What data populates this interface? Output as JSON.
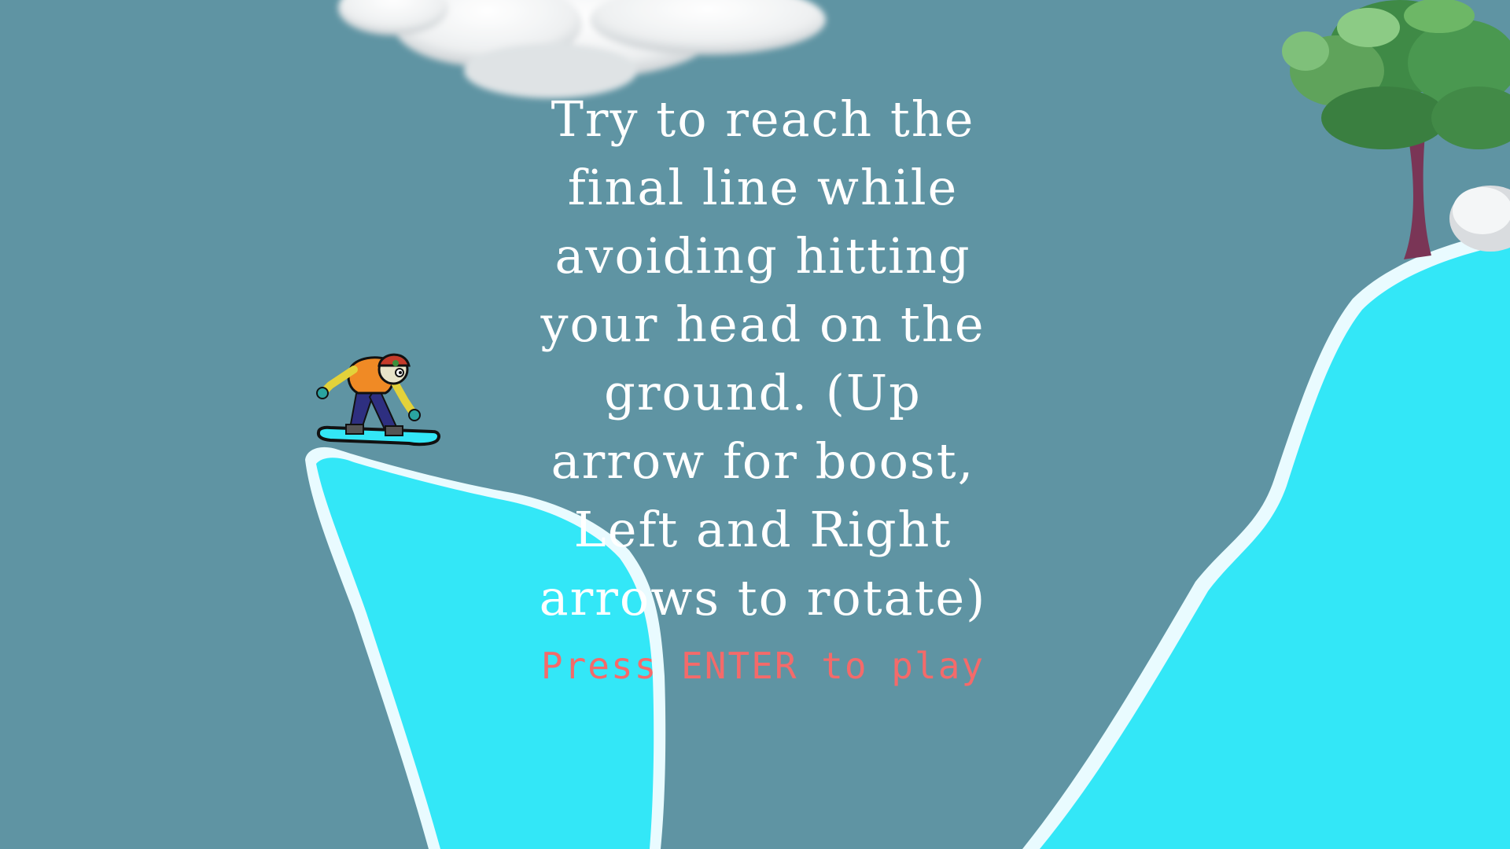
{
  "game": {
    "instructions_text": "Try to reach the\nfinal line while\navoiding hitting\nyour head on the\nground. (Up\narrow for boost,\nLeft and Right\narrows to rotate)",
    "start_prompt": "Press ENTER to play"
  },
  "icons": {
    "player": "snowboarder-icon",
    "cloud": "cloud-icon",
    "tree": "tree-icon",
    "rock": "snow-rock-icon"
  },
  "colors": {
    "sky": "#5f94a3",
    "snow": "#33e7f7",
    "snow_edge": "#e9fbff",
    "text": "#ffffff",
    "prompt": "#f46a6a"
  }
}
